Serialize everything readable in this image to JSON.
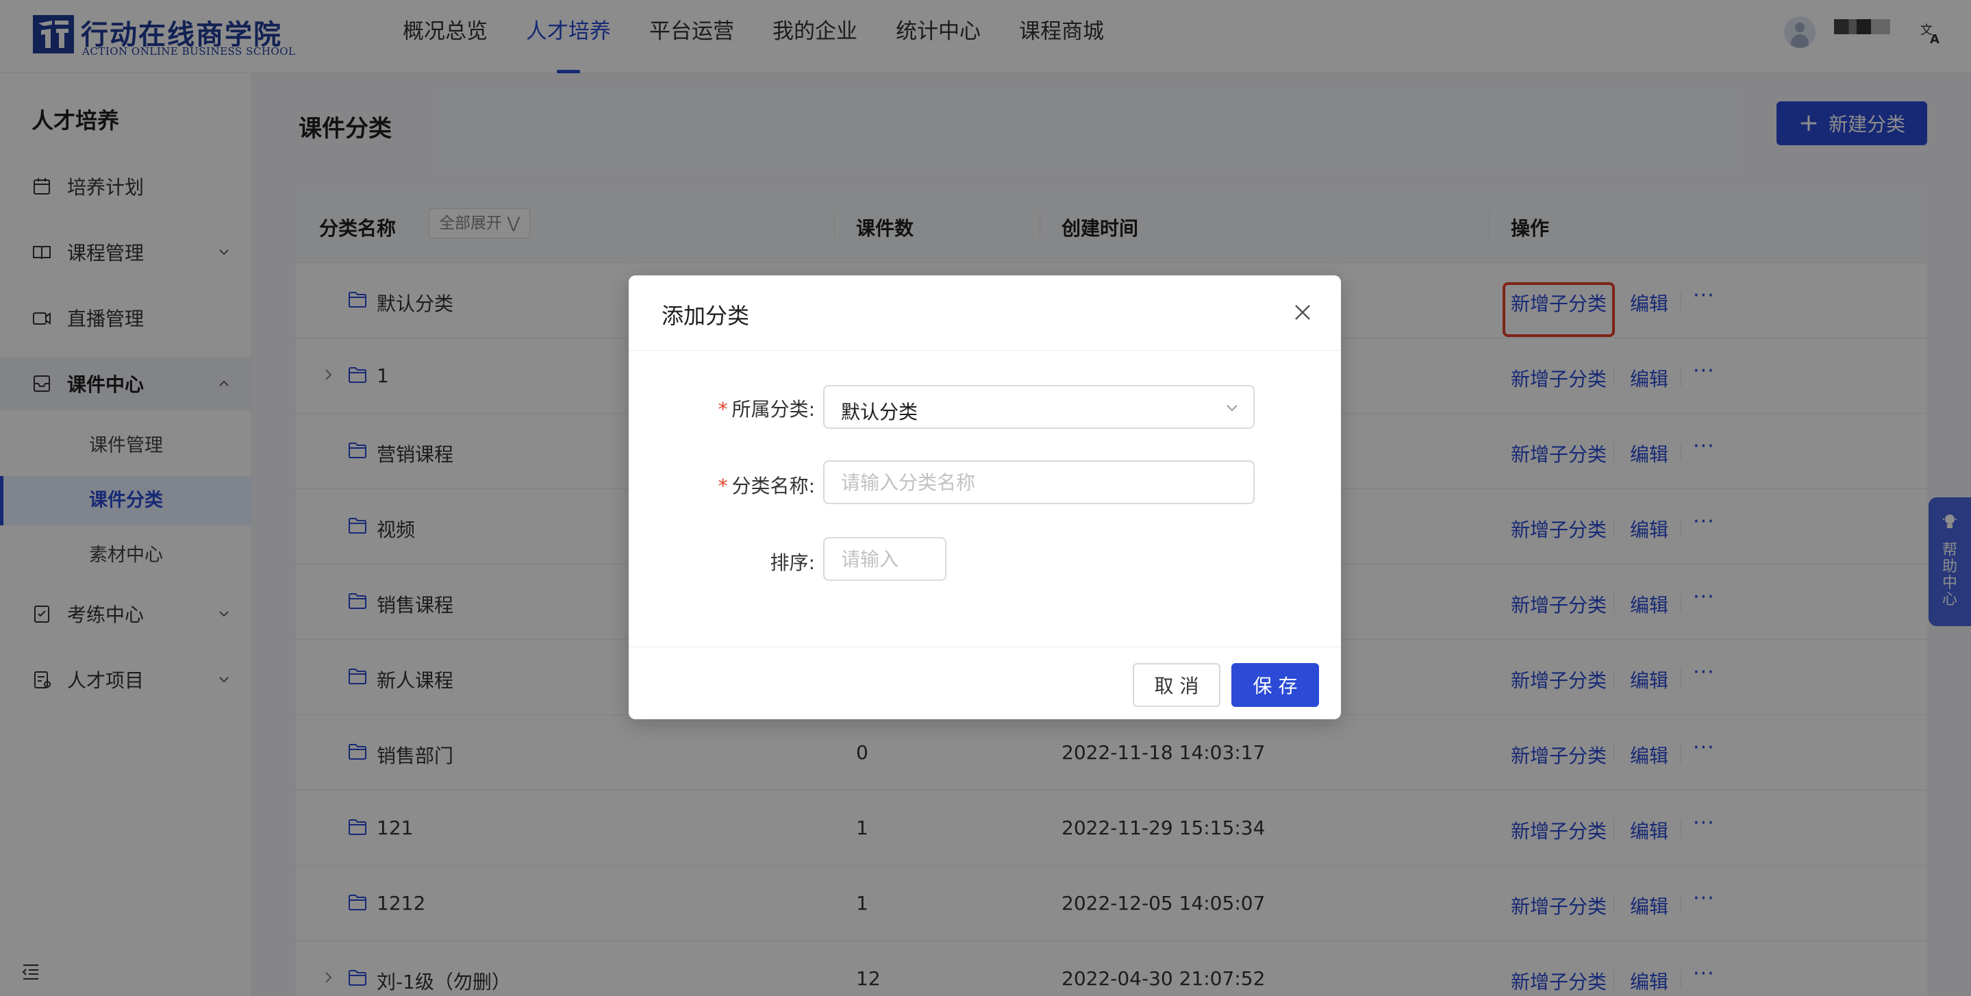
{
  "header": {
    "logo_cn": "行动在线商学院",
    "logo_en": "ACTION ONLINE BUSINESS SCHOOL",
    "nav": [
      {
        "label": "概况总览",
        "active": false
      },
      {
        "label": "人才培养",
        "active": true
      },
      {
        "label": "平台运营",
        "active": false
      },
      {
        "label": "我的企业",
        "active": false
      },
      {
        "label": "统计中心",
        "active": false
      },
      {
        "label": "课程商城",
        "active": false
      }
    ],
    "icons": {
      "avatar": "user-avatar-icon",
      "language": "translate-icon"
    }
  },
  "sidebar": {
    "title": "人才培养",
    "items": [
      {
        "label": "培养计划",
        "icon": "calendar-icon"
      },
      {
        "label": "课程管理",
        "icon": "book-icon",
        "expandable": true
      },
      {
        "label": "直播管理",
        "icon": "video-icon"
      },
      {
        "label": "课件中心",
        "icon": "inbox-icon",
        "expandable": true,
        "open": true
      },
      {
        "label": "考练中心",
        "icon": "exam-icon",
        "expandable": true
      },
      {
        "label": "人才项目",
        "icon": "project-icon",
        "expandable": true
      }
    ],
    "sub_items": [
      {
        "label": "课件管理",
        "active": false
      },
      {
        "label": "课件分类",
        "active": true
      },
      {
        "label": "素材中心",
        "active": false
      }
    ]
  },
  "main": {
    "page_title": "课件分类",
    "new_button_label": "新建分类",
    "table": {
      "columns": [
        "分类名称",
        "课件数",
        "创建时间",
        "操作"
      ],
      "expand_all_label": "全部展开",
      "actions": {
        "add_child": "新增子分类",
        "edit": "编辑",
        "more": "···"
      },
      "rows": [
        {
          "name": "默认分类",
          "count": "",
          "created": "",
          "has_children": false
        },
        {
          "name": "1",
          "count": "",
          "created": "",
          "has_children": true
        },
        {
          "name": "营销课程",
          "count": "",
          "created": "",
          "has_children": false
        },
        {
          "name": "视频",
          "count": "",
          "created": "",
          "has_children": false
        },
        {
          "name": "销售课程",
          "count": "",
          "created": "",
          "has_children": false
        },
        {
          "name": "新人课程",
          "count": "",
          "created": "",
          "has_children": false
        },
        {
          "name": "销售部门",
          "count": "0",
          "created": "2022-11-18 14:03:17",
          "has_children": false
        },
        {
          "name": "121",
          "count": "1",
          "created": "2022-11-29 15:15:34",
          "has_children": false
        },
        {
          "name": "1212",
          "count": "1",
          "created": "2022-12-05 14:05:07",
          "has_children": false
        },
        {
          "name": "刘-1级（勿删）",
          "count": "12",
          "created": "2022-04-30 21:07:52",
          "has_children": true
        }
      ]
    }
  },
  "help_widget": {
    "label": "帮助中心"
  },
  "modal": {
    "title": "添加分类",
    "fields": {
      "parent": {
        "label": "所属分类",
        "value": "默认分类",
        "required": true
      },
      "name": {
        "label": "分类名称",
        "placeholder": "请输入分类名称",
        "value": "",
        "required": true
      },
      "order": {
        "label": "排序",
        "placeholder": "请输入",
        "value": "",
        "required": false
      }
    },
    "label_suffix": ":",
    "cancel_label": "取 消",
    "save_label": "保 存"
  },
  "colors": {
    "primary": "#2b4bd6",
    "brand_logo": "#213c9a",
    "highlight_outline": "#e5402a",
    "required_mark": "#e5402a"
  }
}
